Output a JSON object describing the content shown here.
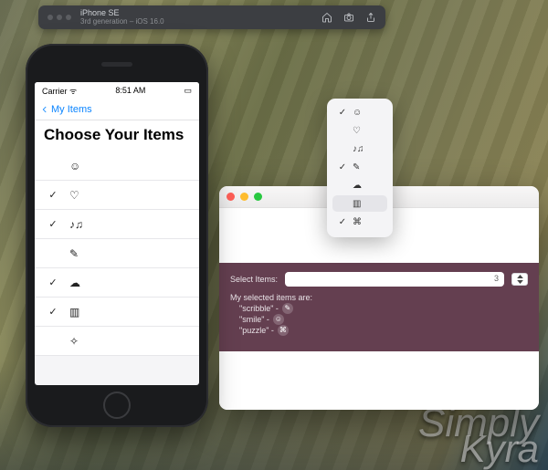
{
  "sim_banner": {
    "title": "iPhone SE",
    "subtitle": "3rd generation – iOS 16.0"
  },
  "iphone": {
    "carrier": "Carrier",
    "time": "8:51 AM",
    "back_label": "My Items",
    "page_title": "Choose Your Items",
    "rows": [
      {
        "checked": false,
        "glyph": "☺",
        "name": "smile"
      },
      {
        "checked": true,
        "glyph": "♡",
        "name": "heart"
      },
      {
        "checked": true,
        "glyph": "♪♫",
        "name": "notes"
      },
      {
        "checked": false,
        "glyph": "✎",
        "name": "scribble"
      },
      {
        "checked": true,
        "glyph": "☁",
        "name": "cloud"
      },
      {
        "checked": true,
        "glyph": "▥",
        "name": "keyboard"
      },
      {
        "checked": false,
        "glyph": "✧",
        "name": "puzzle"
      }
    ]
  },
  "popover": {
    "rows": [
      {
        "checked": true,
        "glyph": "☺",
        "selected": false
      },
      {
        "checked": false,
        "glyph": "♡",
        "selected": false
      },
      {
        "checked": false,
        "glyph": "♪♫",
        "selected": false
      },
      {
        "checked": true,
        "glyph": "✎",
        "selected": false
      },
      {
        "checked": false,
        "glyph": "☁",
        "selected": false
      },
      {
        "checked": false,
        "glyph": "▥",
        "selected": true
      },
      {
        "checked": true,
        "glyph": "⌘",
        "selected": false
      }
    ]
  },
  "mac": {
    "select_label": "Select Items:",
    "selected_count": "3",
    "result_heading": "My selected items are:",
    "results": [
      {
        "label": "\"scribble\" - ",
        "glyph": "✎"
      },
      {
        "label": "\"smile\" - ",
        "glyph": "☺"
      },
      {
        "label": "\"puzzle\" - ",
        "glyph": "⌘"
      }
    ]
  },
  "watermark": {
    "line1": "Simply",
    "line2": "Kyra"
  }
}
